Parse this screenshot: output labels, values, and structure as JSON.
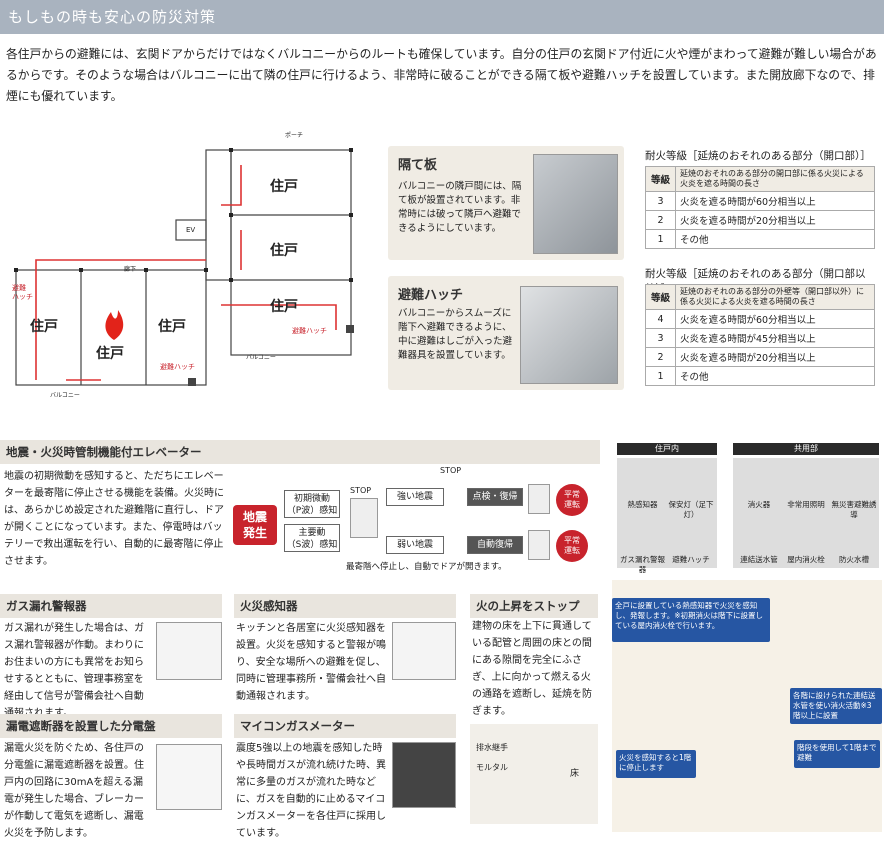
{
  "header": {
    "title": "もしもの時も安心の防災対策"
  },
  "intro": "各住戸からの避難には、玄関ドアからだけではなくバルコニーからのルートも確保しています。自分の住戸の玄関ドア付近に火や煙がまわって避難が難しい場合があるからです。そのような場合はバルコニーに出て隣の住戸に行けるよう、非常時に破ることができる隔て板や避難ハッチを設置しています。また開放廊下なので、排煙にも優れています。",
  "plan": {
    "unit": "住戸",
    "fire_unit": "住戸",
    "hatch": "避難ハッチ",
    "hatch_left": "避難\nハッチ",
    "balcony": "バルコニー",
    "ev": "EV",
    "hall": "廊下",
    "porch": "ポーチ"
  },
  "partition": {
    "title": "隔て板",
    "text": "バルコニーの隣戸間には、隔て板が設置されています。非常時には破って隣戸へ避難できるようにしています。"
  },
  "hatch": {
    "title": "避難ハッチ",
    "text": "バルコニーからスムーズに階下へ避難できるように、中に避難はしごが入った避難器具を設置しています。"
  },
  "fire1": {
    "title": "耐火等級［延焼のおそれのある部分（開口部）］",
    "head_grade": "等級",
    "head_desc": "延焼のおそれのある部分の開口部に係る火災による火炎を遮る時間の長さ",
    "rows": [
      {
        "g": "3",
        "d": "火炎を遮る時間が60分相当以上"
      },
      {
        "g": "2",
        "d": "火炎を遮る時間が20分相当以上"
      },
      {
        "g": "1",
        "d": "その他"
      }
    ]
  },
  "fire2": {
    "title": "耐火等級［延焼のおそれのある部分（開口部以外）］",
    "head_grade": "等級",
    "head_desc": "延焼のおそれのある部分の外壁等（開口部以外）に係る火災による火炎を遮る時間の長さ",
    "rows": [
      {
        "g": "4",
        "d": "火炎を遮る時間が60分相当以上"
      },
      {
        "g": "3",
        "d": "火炎を遮る時間が45分相当以上"
      },
      {
        "g": "2",
        "d": "火炎を遮る時間が20分相当以上"
      },
      {
        "g": "1",
        "d": "その他"
      }
    ]
  },
  "elevator": {
    "title": "地震・火災時管制機能付エレベーター",
    "text": "地震の初期微動を感知すると、ただちにエレベーターを最寄階に停止させる機能を装備。火災時には、あらかじめ設定された避難階に直行し、ドアが開くことになっています。また、停電時はバッテリーで救出運転を行い、自動的に最寄階に停止させます。",
    "flow": {
      "quake": "地震\n発生",
      "p_wave": "初期微動\n（P波）感知",
      "s_wave": "主要動\n（S波）感知",
      "stop": "STOP",
      "stop2": "STOP",
      "strong": "強い地震",
      "weak": "弱い地震",
      "check": "点検・復帰",
      "auto": "自動復帰",
      "normal1": "平常\n運転",
      "normal2": "平常\n運転",
      "note": "最寄階へ停止し、自動でドアが開きます。"
    }
  },
  "equip": {
    "inside": "住戸内",
    "common": "共用部",
    "items_in": [
      "熱感知器",
      "保安灯（足下灯）",
      "ガス漏れ警報器",
      "避難ハッチ"
    ],
    "items_common": [
      "消火器",
      "非常用照明",
      "無災害避難誘導",
      "連結送水管",
      "屋内消火栓",
      "防火水槽"
    ]
  },
  "gas": {
    "title": "ガス漏れ警報器",
    "text": "ガス漏れが発生した場合は、ガス漏れ警報器が作動。まわりにお住まいの方にも異常をお知らせするとともに、管理事務室を経由して信号が警備会社へ自動通報されます。"
  },
  "detector": {
    "title": "火災感知器",
    "text": "キッチンと各居室に火災感知器を設置。火災を感知すると警報が鳴り、安全な場所への避難を促し、同時に管理事務所・警備会社へ自動通報されます。"
  },
  "stopper": {
    "title": "火の上昇をストップ",
    "text": "建物の床を上下に貫通している配管と周囲の床との間にある隙間を完全にふさぎ、上に向かって燃える火の通路を遮断し、延焼を防ぎます。",
    "pipe": "排水継手",
    "mortar": "モルタル",
    "floor": "床"
  },
  "breaker": {
    "title": "漏電遮断器を設置した分電盤",
    "text": "漏電火災を防ぐため、各住戸の分電盤に漏電遮断器を設置。住戸内の回路に30mAを超える漏電が発生した場合、ブレーカーが作動して電気を遮断し、漏電火災を予防します。"
  },
  "meter": {
    "title": "マイコンガスメーター",
    "text": "震度5強以上の地震を感知した時や長時間ガスが流れ続けた時、異常に多量のガスが流れた時などに、ガスを自動的に止めるマイコンガスメーターを各住戸に採用しています。"
  },
  "building": {
    "callout1": "全戸に設置している熱感知器で火災を感知し、発報します。※初期消火は階下に設置している屋内消火栓で行います。",
    "callout2": "各階に設けられた連結送水管を使い消火活動※3階以上に設置",
    "callout3": "火災を感知すると1階に停止します",
    "callout4": "階段を使用して1階まで避難"
  },
  "colors": {
    "accent": "#2656a3",
    "red": "#c8232c",
    "topbar": "#a9b3bf"
  }
}
